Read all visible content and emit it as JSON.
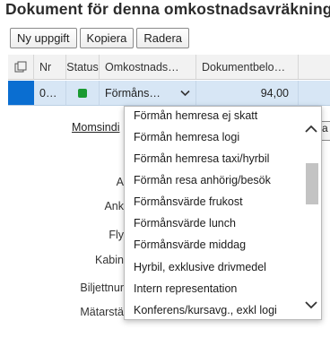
{
  "title": "Dokument för denna omkostnadsavräkning",
  "toolbar": {
    "new_label": "Ny uppgift",
    "copy_label": "Kopiera",
    "delete_label": "Radera"
  },
  "table": {
    "headers": {
      "select_icon": "select-all-icon",
      "nr": "Nr",
      "status": "Status",
      "omkostnad": "Omkostnads…",
      "dokumentbelopp": "Dokumentbelo…"
    },
    "row": {
      "nr": "0…",
      "status_color": "#1a9a31",
      "omkostnad": "Förmåns…",
      "dokumentbelopp": "94,00"
    }
  },
  "form": {
    "momsindi": "Momsindi",
    "labels": [
      "A",
      "Ank",
      "Fly",
      "Kabin",
      "Biljettnur",
      "Mätarstä"
    ],
    "side_button": "a"
  },
  "dropdown": {
    "items": [
      "Förmån hemresa ej skatt",
      "Förmån hemresa logi",
      "Förmån hemresa taxi/hyrbil",
      "Förmån resa anhörig/besök",
      "Förmånsvärde frukost",
      "Förmånsvärde lunch",
      "Förmånsvärde middag",
      "Hyrbil, exklusive drivmedel",
      "Intern representation",
      "Konferens/kursavg., exkl logi"
    ]
  },
  "colors": {
    "accent": "#0a6ed1",
    "selected_row": "#d7e6f5",
    "status_green": "#1a9a31"
  }
}
